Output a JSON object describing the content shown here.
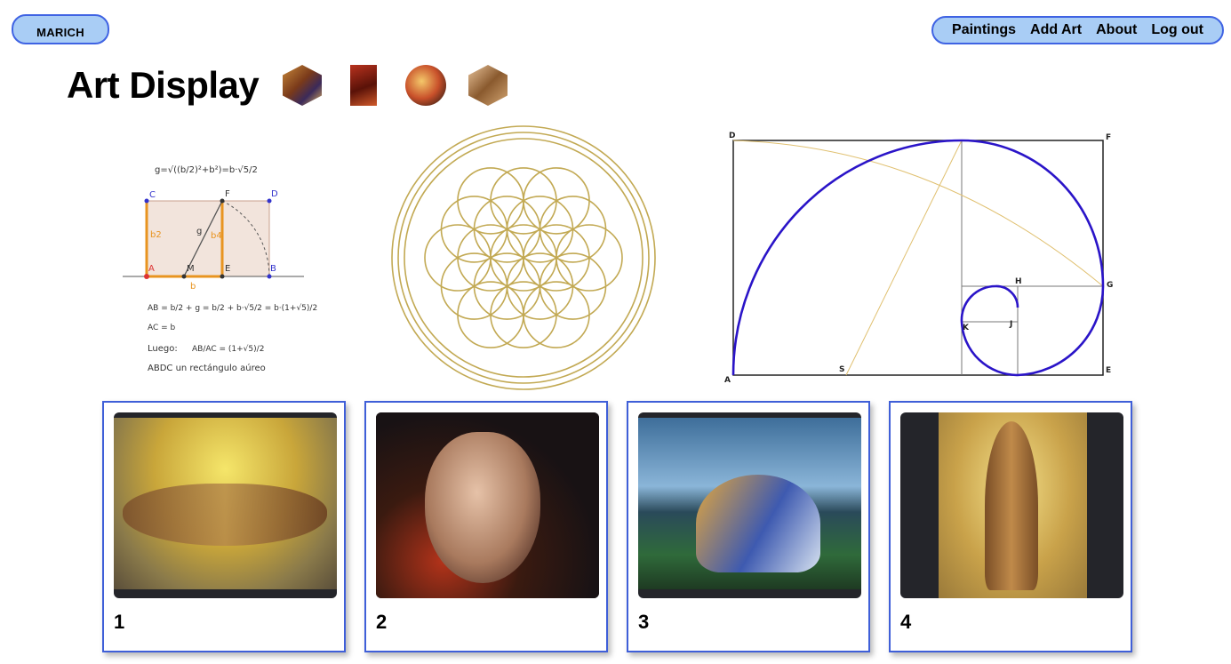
{
  "brand": "MARICH",
  "nav": [
    "Paintings",
    "Add Art",
    "About",
    "Log out"
  ],
  "title": "Art Display",
  "diagram": {
    "formula_top": "g=√((b/2)²+b²)=b·√5/2",
    "labels": {
      "C": "C",
      "F": "F",
      "D": "D",
      "A": "A",
      "M": "M",
      "E": "E",
      "B": "B",
      "b2": "b2",
      "b4": "b4",
      "g": "g",
      "b": "b"
    },
    "eq1": "AB = b/2 + g = b/2 + b·√5/2 = b·(1+√5)/2",
    "eq2": "AC = b",
    "luego": "Luego:",
    "ratio": "AB/AC = (1+√5)/2",
    "conclusion": "ABDC   un   rectángulo   aúreo"
  },
  "spiral_labels": {
    "D": "D",
    "F": "F",
    "G": "G",
    "H": "H",
    "K": "K",
    "J": "J",
    "S": "S",
    "E": "E",
    "A": "A"
  },
  "cards": [
    {
      "number": "1"
    },
    {
      "number": "2"
    },
    {
      "number": "3"
    },
    {
      "number": "4"
    }
  ]
}
